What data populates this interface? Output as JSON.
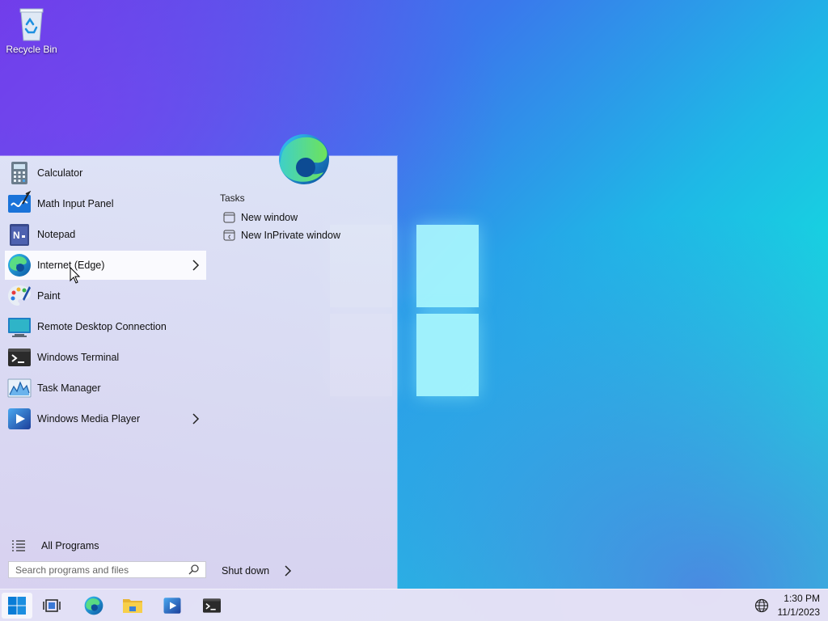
{
  "desktop": {
    "icons": [
      {
        "label": "Recycle Bin",
        "icon": "recycle-bin-icon"
      }
    ]
  },
  "start_menu": {
    "apps": [
      {
        "label": "Calculator",
        "icon": "calculator-icon",
        "has_submenu": false
      },
      {
        "label": "Math Input Panel",
        "icon": "math-input-panel-icon",
        "has_submenu": false
      },
      {
        "label": "Notepad",
        "icon": "notepad-icon",
        "has_submenu": false
      },
      {
        "label": "Internet (Edge)",
        "icon": "edge-icon",
        "has_submenu": true,
        "highlighted": true
      },
      {
        "label": "Paint",
        "icon": "paint-icon",
        "has_submenu": false
      },
      {
        "label": "Remote Desktop Connection",
        "icon": "remote-desktop-icon",
        "has_submenu": false
      },
      {
        "label": "Windows Terminal",
        "icon": "terminal-icon",
        "has_submenu": false
      },
      {
        "label": "Task Manager",
        "icon": "task-manager-icon",
        "has_submenu": false
      },
      {
        "label": "Windows Media Player",
        "icon": "media-player-icon",
        "has_submenu": true
      }
    ],
    "all_programs_label": "All Programs",
    "search": {
      "placeholder": "Search programs and files"
    },
    "shutdown_label": "Shut down",
    "jump_list": {
      "title": "Tasks",
      "items": [
        {
          "label": "New window",
          "icon": "window-icon"
        },
        {
          "label": "New InPrivate window",
          "icon": "inprivate-window-icon"
        }
      ]
    }
  },
  "taskbar": {
    "buttons": [
      {
        "name": "start",
        "icon": "windows-logo-icon"
      },
      {
        "name": "task-view",
        "icon": "task-view-icon"
      },
      {
        "name": "edge",
        "icon": "edge-icon"
      },
      {
        "name": "file-explorer",
        "icon": "folder-icon"
      },
      {
        "name": "media-player",
        "icon": "media-player-icon"
      },
      {
        "name": "terminal",
        "icon": "terminal-icon"
      }
    ],
    "tray": {
      "icon": "globe-icon"
    },
    "clock": {
      "time": "1:30 PM",
      "date": "11/1/2023"
    }
  },
  "colors": {
    "accent": "#0078d4",
    "menu_bg": "#e2e4f4",
    "highlight": "#ffffff"
  }
}
